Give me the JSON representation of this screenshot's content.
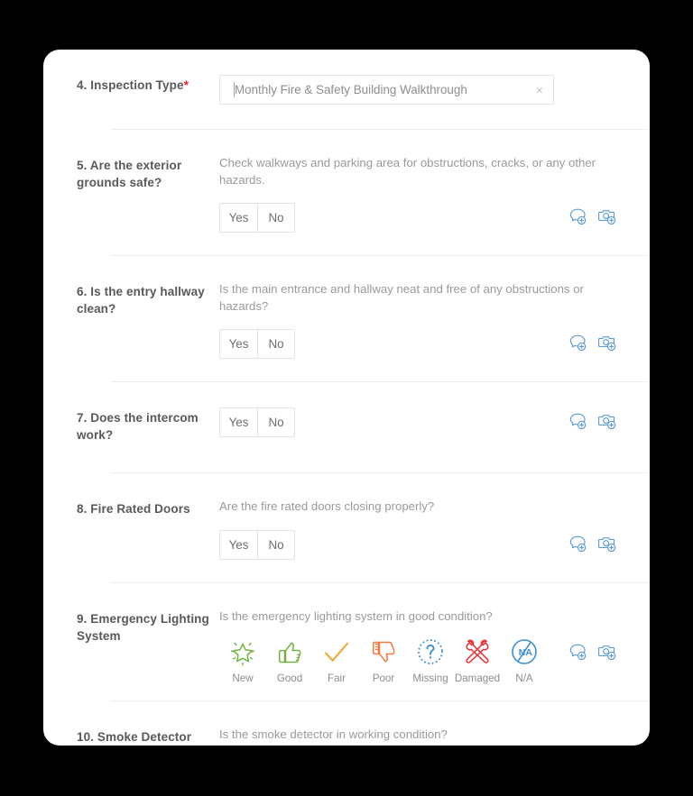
{
  "theme": {
    "card_bg": "#ffffff",
    "page_bg": "#000000",
    "label_color": "#58595b",
    "desc_color": "#9a9a9e",
    "required_color": "#e8262a",
    "divider_color": "#eeeeee",
    "action_icon_color": "#5b9bd5",
    "rating_green": "#72b043",
    "rating_amber": "#f2a93b",
    "rating_orange": "#ef7b45",
    "rating_blue": "#3f8fd0",
    "rating_red": "#e03a3e"
  },
  "form": {
    "questions": [
      {
        "number": "4.",
        "label": "4. Inspection Type",
        "required": true,
        "required_mark": "*",
        "description": "",
        "control": "text",
        "value": "Monthly Fire & Safety Building Walkthrough",
        "clear_icon": "×",
        "actions": []
      },
      {
        "number": "5.",
        "label": "5. Are the exterior grounds safe?",
        "required": false,
        "description": "Check walkways and parking area for obstructions, cracks, or any other hazards.",
        "control": "yesno",
        "options": [
          "Yes",
          "No"
        ],
        "actions": [
          "add-comment-icon",
          "add-photo-icon"
        ]
      },
      {
        "number": "6.",
        "label": "6. Is the entry hallway clean?",
        "required": false,
        "description": "Is the main entrance and hallway neat and free of any obstructions or hazards?",
        "control": "yesno",
        "options": [
          "Yes",
          "No"
        ],
        "actions": [
          "add-comment-icon",
          "add-photo-icon"
        ]
      },
      {
        "number": "7.",
        "label": "7. Does the intercom work?",
        "required": false,
        "description": "",
        "control": "yesno",
        "options": [
          "Yes",
          "No"
        ],
        "actions": [
          "add-comment-icon",
          "add-photo-icon"
        ]
      },
      {
        "number": "8.",
        "label": "8. Fire Rated Doors",
        "required": false,
        "description": "Are the fire rated doors closing properly?",
        "control": "yesno",
        "options": [
          "Yes",
          "No"
        ],
        "actions": [
          "add-comment-icon",
          "add-photo-icon"
        ]
      },
      {
        "number": "9.",
        "label": "9. Emergency Lighting System",
        "required": false,
        "description": "Is the emergency lighting system in good condition?",
        "control": "ratings",
        "ratings": [
          {
            "label": "New",
            "icon": "star-sparkle-icon",
            "color": "#72b043"
          },
          {
            "label": "Good",
            "icon": "thumbs-up-icon",
            "color": "#72b043"
          },
          {
            "label": "Fair",
            "icon": "checkmark-icon",
            "color": "#f2a93b"
          },
          {
            "label": "Poor",
            "icon": "thumbs-down-icon",
            "color": "#ef7b45"
          },
          {
            "label": "Missing",
            "icon": "question-dotted-icon",
            "color": "#3f8fd0"
          },
          {
            "label": "Damaged",
            "icon": "crossed-wrenches-icon",
            "color": "#e03a3e"
          },
          {
            "label": "N/A",
            "icon": "not-applicable-icon",
            "color": "#3f8fd0"
          }
        ],
        "actions": [
          "add-comment-icon",
          "add-photo-icon"
        ]
      },
      {
        "number": "10.",
        "label": "10. Smoke Detector",
        "required": false,
        "description": "Is the smoke detector in working condition?",
        "control": "none",
        "actions": []
      }
    ]
  }
}
